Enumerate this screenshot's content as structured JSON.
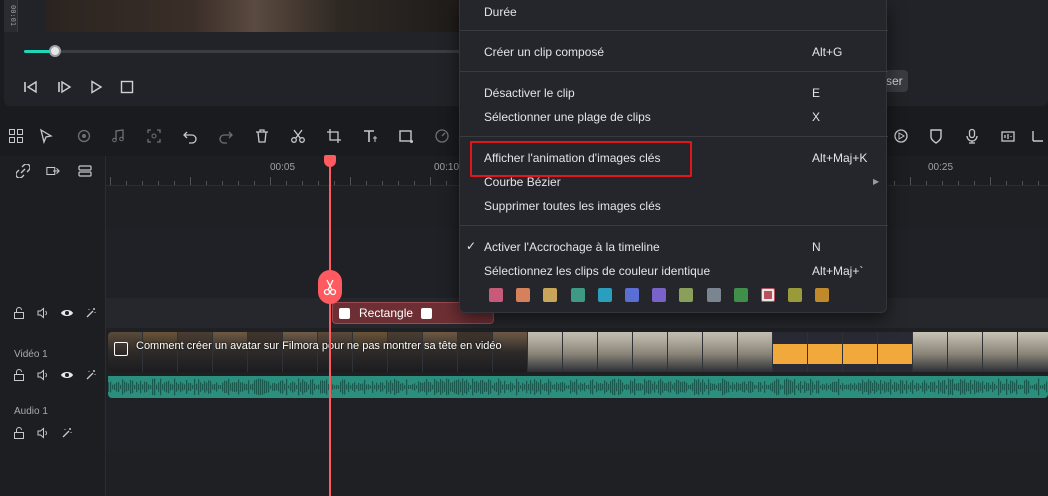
{
  "player": {
    "timecode_fragment": "00:01",
    "progress": 0.07,
    "controls": [
      "prev-frame-icon",
      "next-frame-icon",
      "play-icon",
      "stop-icon"
    ]
  },
  "tooltip_fragment": "ser",
  "toolbar": {
    "icons": [
      "layout-icon",
      "select-tool-icon",
      "ripple-edit-icon",
      "music-icon",
      "crop-icon",
      "undo-icon",
      "redo-icon",
      "delete-icon",
      "cut-icon",
      "transform-icon",
      "text-icon",
      "rectangle-icon",
      "speed-icon",
      "voiceover-icon",
      "shield-icon",
      "mic-icon",
      "settings-icon"
    ]
  },
  "timeline": {
    "ruler_labels": [
      "00:05",
      "00:10",
      "00:25"
    ],
    "tracks": [
      {
        "name": "Vidéo 1"
      },
      {
        "name": "Audio 1"
      }
    ],
    "title_clip": "Rectangle",
    "video_clip_title": "Comment créer un avatar sur Filmora pour ne pas montrer sa tête en vidéo"
  },
  "menu": {
    "items": [
      {
        "label": "Durée",
        "shortcut": ""
      },
      {
        "label": "Créer un clip composé",
        "shortcut": "Alt+G"
      },
      {
        "label": "Désactiver le clip",
        "shortcut": "E"
      },
      {
        "label": "Sélectionner une plage de clips",
        "shortcut": "X"
      },
      {
        "label": "Afficher l'animation d'images clés",
        "shortcut": "Alt+Maj+K"
      },
      {
        "label": "Courbe Bézier",
        "shortcut": ""
      },
      {
        "label": "Supprimer toutes les images clés",
        "shortcut": ""
      },
      {
        "label": "Activer l'Accrochage à la timeline",
        "shortcut": "N",
        "checked": true
      },
      {
        "label": "Sélectionnez les clips de couleur identique",
        "shortcut": "Alt+Maj+`"
      }
    ],
    "color_swatches": [
      "#c75a78",
      "#d6815c",
      "#c9a55a",
      "#3e9a85",
      "#2a9fbd",
      "#5a6fd6",
      "#7a62c9",
      "#8aa05a",
      "#7a8590",
      "#3f8f4a",
      "#b5525a",
      "#9a9a3a",
      "#c08a2a"
    ],
    "selected_swatch_index": 10
  },
  "highlight_color": "#e0161d",
  "accent_color": "#1fd6b8",
  "playhead_color": "#ff5a5f"
}
